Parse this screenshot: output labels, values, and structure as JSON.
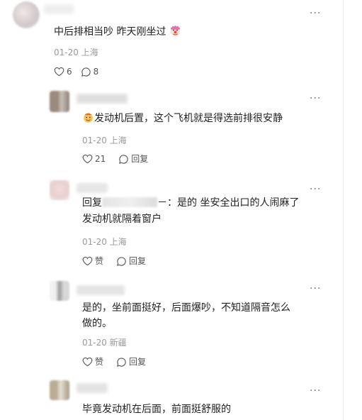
{
  "comments": [
    {
      "text": "中后排相当吵 昨天刚坐过",
      "meta": "01-20 上海",
      "like_count": "6",
      "reply_count": "8",
      "more_label": "···"
    },
    {
      "text": "发动机后置，这个飞机就是得选前排很安静",
      "meta": "01-20 上海",
      "like_count": "21",
      "reply_label": "回复",
      "more_label": "···"
    },
    {
      "reply_prefix": "回复",
      "text_line1": "－：是的 坐安全出口的人闹麻了",
      "text_line2": "发动机就隔着窗户",
      "meta": "01-20 上海",
      "like_label": "赞",
      "reply_label": "回复",
      "more_label": "···"
    },
    {
      "text_line1": "是的，坐前面挺好，后面爆吵，不知道隔音怎么",
      "text_line2": "做的。",
      "meta": "01-20 新疆",
      "like_label": "赞",
      "reply_label": "回复",
      "more_label": "···"
    },
    {
      "text": "毕竟发动机在后面，前面挺舒服的",
      "more_label": "···"
    }
  ],
  "icons": [
    "heart-icon",
    "comment-bubble-icon",
    "more-dots-icon",
    "clown-emoji-icon",
    "smiling-emoji-icon"
  ]
}
